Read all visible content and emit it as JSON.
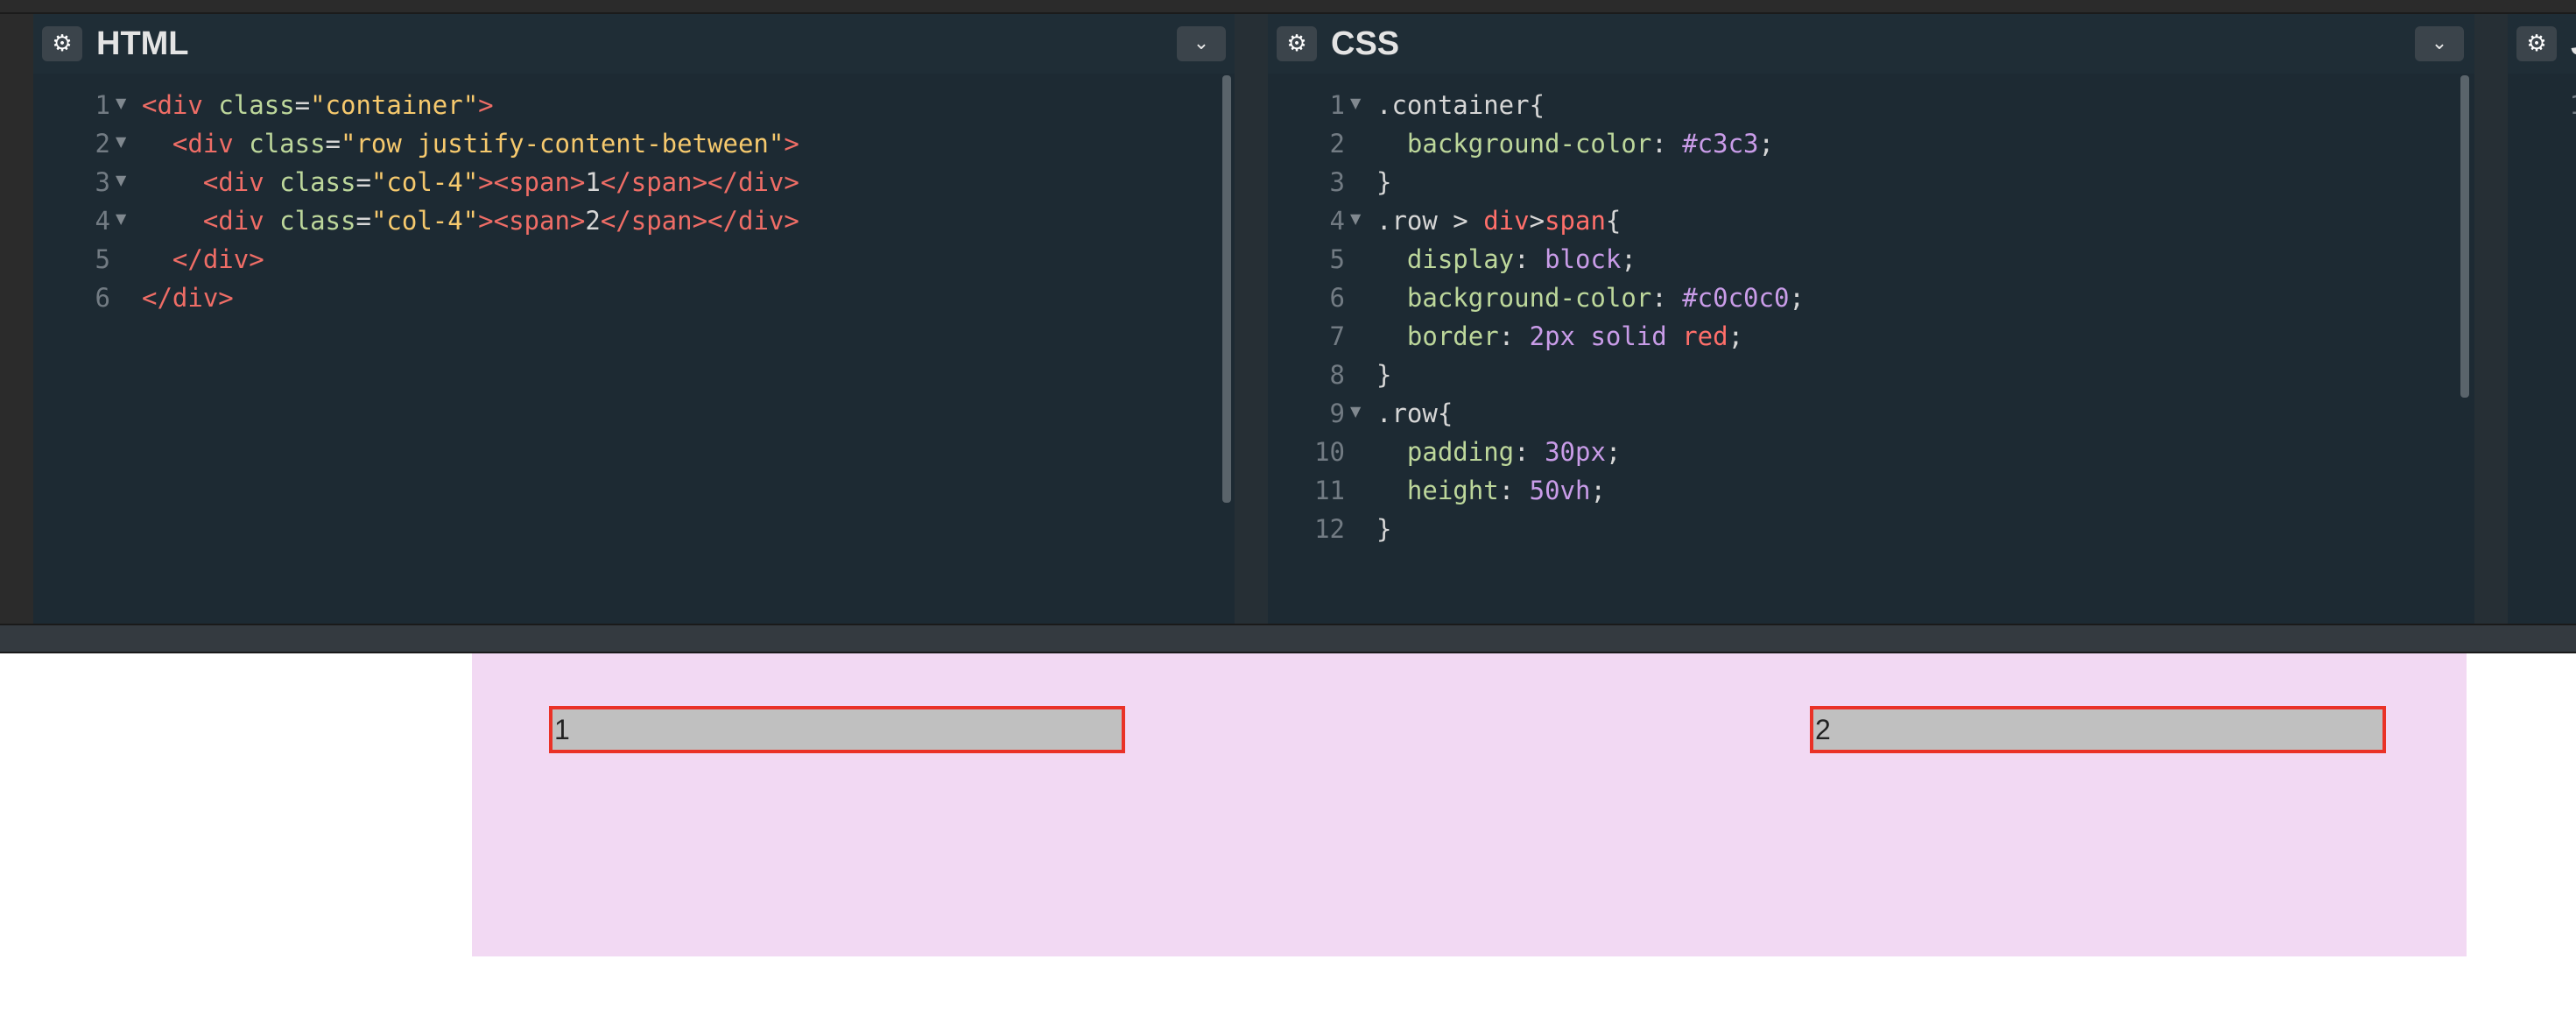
{
  "panels": {
    "html": {
      "title": "HTML",
      "lines": [
        {
          "n": "1",
          "fold": true,
          "tokens": [
            [
              "t",
              "<div "
            ],
            [
              "a",
              "class"
            ],
            [
              "",
              "="
            ],
            [
              "s",
              "\"container\""
            ],
            [
              "t",
              ">"
            ]
          ]
        },
        {
          "n": "2",
          "fold": true,
          "tokens": [
            [
              "",
              "  "
            ],
            [
              "t",
              "<div "
            ],
            [
              "a",
              "class"
            ],
            [
              "",
              "="
            ],
            [
              "s",
              "\"row justify-content-between\""
            ],
            [
              "t",
              ">"
            ]
          ]
        },
        {
          "n": "3",
          "fold": true,
          "tokens": [
            [
              "",
              "    "
            ],
            [
              "t",
              "<div "
            ],
            [
              "a",
              "class"
            ],
            [
              "",
              "="
            ],
            [
              "s",
              "\"col-4\""
            ],
            [
              "t",
              "><span>"
            ],
            [
              "",
              "1"
            ],
            [
              "t",
              "</span></div>"
            ]
          ]
        },
        {
          "n": "4",
          "fold": true,
          "tokens": [
            [
              "",
              "    "
            ],
            [
              "t",
              "<div "
            ],
            [
              "a",
              "class"
            ],
            [
              "",
              "="
            ],
            [
              "s",
              "\"col-4\""
            ],
            [
              "t",
              "><span>"
            ],
            [
              "",
              "2"
            ],
            [
              "t",
              "</span></div>"
            ]
          ]
        },
        {
          "n": "5",
          "fold": false,
          "tokens": [
            [
              "",
              "  "
            ],
            [
              "t",
              "</div>"
            ]
          ]
        },
        {
          "n": "6",
          "fold": false,
          "tokens": [
            [
              "t",
              "</div>"
            ]
          ]
        }
      ]
    },
    "css": {
      "title": "CSS",
      "lines": [
        {
          "n": "1",
          "fold": true,
          "tokens": [
            [
              "",
              ".container{"
            ]
          ]
        },
        {
          "n": "2",
          "fold": false,
          "tokens": [
            [
              "",
              "  "
            ],
            [
              "a",
              "background-color"
            ],
            [
              "",
              ": "
            ],
            [
              "v",
              "#c3c3"
            ],
            [
              "",
              ";"
            ]
          ]
        },
        {
          "n": "3",
          "fold": false,
          "tokens": [
            [
              "",
              "}"
            ]
          ]
        },
        {
          "n": "4",
          "fold": true,
          "tokens": [
            [
              "",
              ".row > "
            ],
            [
              "p",
              "div"
            ],
            [
              "",
              ">",
              " "
            ],
            [
              "p",
              "span"
            ],
            [
              "",
              "{"
            ]
          ]
        },
        {
          "n": "5",
          "fold": false,
          "tokens": [
            [
              "",
              "  "
            ],
            [
              "a",
              "display"
            ],
            [
              "",
              ": "
            ],
            [
              "v",
              "block"
            ],
            [
              "",
              ";"
            ]
          ]
        },
        {
          "n": "6",
          "fold": false,
          "tokens": [
            [
              "",
              "  "
            ],
            [
              "a",
              "background-color"
            ],
            [
              "",
              ": "
            ],
            [
              "v",
              "#c0c0c0"
            ],
            [
              "",
              ";"
            ]
          ]
        },
        {
          "n": "7",
          "fold": false,
          "tokens": [
            [
              "",
              "  "
            ],
            [
              "a",
              "border"
            ],
            [
              "",
              ": "
            ],
            [
              "v",
              "2px solid "
            ],
            [
              "p",
              "red"
            ],
            [
              "",
              ";"
            ]
          ]
        },
        {
          "n": "8",
          "fold": false,
          "tokens": [
            [
              "",
              "}"
            ]
          ]
        },
        {
          "n": "9",
          "fold": true,
          "tokens": [
            [
              "",
              ".row{"
            ]
          ]
        },
        {
          "n": "10",
          "fold": false,
          "tokens": [
            [
              "",
              "  "
            ],
            [
              "a",
              "padding"
            ],
            [
              "",
              ": "
            ],
            [
              "v",
              "30px"
            ],
            [
              "",
              ";"
            ]
          ]
        },
        {
          "n": "11",
          "fold": false,
          "tokens": [
            [
              "",
              "  "
            ],
            [
              "a",
              "height"
            ],
            [
              "",
              ": "
            ],
            [
              "v",
              "50vh"
            ],
            [
              "",
              ";"
            ]
          ]
        },
        {
          "n": "12",
          "fold": false,
          "tokens": [
            [
              "",
              "}"
            ]
          ]
        }
      ]
    },
    "js": {
      "title": "JS",
      "lines": [
        {
          "n": "1",
          "fold": false,
          "tokens": []
        }
      ]
    }
  },
  "icons": {
    "settings": "⚙",
    "chevron": "⌄"
  },
  "preview": {
    "items": [
      "1",
      "2"
    ]
  }
}
